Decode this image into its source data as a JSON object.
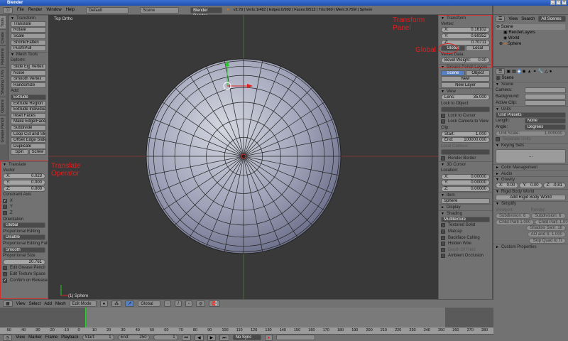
{
  "window": {
    "title": "Blender",
    "controls": [
      "_",
      "▫",
      "×"
    ]
  },
  "info": {
    "menus": [
      "File",
      "Render",
      "Window",
      "Help"
    ],
    "layout": "Default",
    "scene": "Scene",
    "engine": "Blender Render",
    "stats": "v2.79 | Verts:1/482 | Edges:0/992 | Faces:0/512 | Tris:960 | Mem:9.75M | Sphere"
  },
  "tool_tabs": [
    "Tools",
    "Create",
    "Relations",
    "Shading / UVs",
    "Options",
    "Grease Pencil"
  ],
  "toolbar": {
    "rows": [
      {
        "t": "hdr",
        "text": "Transform"
      },
      {
        "t": "btn",
        "text": "Translate"
      },
      {
        "t": "btn",
        "text": "Rotate"
      },
      {
        "t": "btn",
        "text": "Scale"
      },
      {
        "t": "btn",
        "text": "Shrink/Fatten"
      },
      {
        "t": "btn",
        "text": "Push/Pull"
      },
      {
        "t": "hdr",
        "text": "Mesh Tools"
      },
      {
        "t": "label",
        "text": "Deform:"
      },
      {
        "t": "pair",
        "a": "Slide Ed",
        "b": "Vertex"
      },
      {
        "t": "btn",
        "text": "Noise"
      },
      {
        "t": "btn",
        "text": "Smooth Vertex"
      },
      {
        "t": "btn",
        "text": "Randomize"
      },
      {
        "t": "label",
        "text": "Add:"
      },
      {
        "t": "select",
        "text": "Extrude"
      },
      {
        "t": "btn",
        "text": "Extrude Region"
      },
      {
        "t": "btn",
        "text": "Extrude Individual"
      },
      {
        "t": "btn",
        "text": "Inset Faces"
      },
      {
        "t": "btn",
        "text": "Make Edge/Face"
      },
      {
        "t": "btn",
        "text": "Subdivide"
      },
      {
        "t": "btn",
        "text": "Loop Cut and Slide"
      },
      {
        "t": "btn",
        "text": "Offset Edge Slide"
      },
      {
        "t": "btn",
        "text": "Duplicate"
      },
      {
        "t": "pair",
        "a": "Spin",
        "b": "Screw"
      }
    ]
  },
  "operator": {
    "rows": [
      {
        "t": "hdr",
        "text": "Translate"
      },
      {
        "t": "label",
        "text": "Vector"
      },
      {
        "t": "num",
        "label": "X:",
        "value": "0.023"
      },
      {
        "t": "num",
        "label": "Y:",
        "value": "0.000"
      },
      {
        "t": "num",
        "label": "Z:",
        "value": "0.000"
      },
      {
        "t": "label",
        "text": "Constraint Axis"
      },
      {
        "t": "check",
        "text": "X",
        "checked": true
      },
      {
        "t": "check",
        "text": "Y",
        "checked": false
      },
      {
        "t": "check",
        "text": "Z",
        "checked": false
      },
      {
        "t": "label",
        "text": "Orientation"
      },
      {
        "t": "select",
        "text": "Global"
      },
      {
        "t": "label",
        "text": "Proportional Editing"
      },
      {
        "t": "select",
        "text": "Disable"
      },
      {
        "t": "label",
        "text": "Proportional Editing Falloff"
      },
      {
        "t": "select",
        "text": "Smooth"
      },
      {
        "t": "label",
        "text": "Proportional Size"
      },
      {
        "t": "num",
        "label": "",
        "value": "20.761"
      },
      {
        "t": "check",
        "text": "Edit Grease Pencil",
        "checked": false
      },
      {
        "t": "check",
        "text": "Edit Texture Space",
        "checked": false
      },
      {
        "t": "check",
        "text": "Confirm on Release",
        "checked": true
      }
    ]
  },
  "viewport": {
    "view_name": "Top Ortho",
    "object_label": "(1) Sphere"
  },
  "annotations": {
    "transform_panel": "Transform Panel",
    "global": "Global",
    "translate_operator": "Translate Operator"
  },
  "npanel": {
    "rows": [
      {
        "t": "hdr",
        "text": "Transform"
      },
      {
        "t": "label",
        "text": "Vertex:"
      },
      {
        "t": "num",
        "label": "X:",
        "value": "0.16102"
      },
      {
        "t": "num",
        "label": "Y:",
        "value": "0.69352"
      },
      {
        "t": "num",
        "label": "Z:",
        "value": "0.70711"
      },
      {
        "t": "pair",
        "a": "Global",
        "b": "Local",
        "sel": "a"
      },
      {
        "t": "label",
        "text": "Vertex Data:"
      },
      {
        "t": "num",
        "label": "Bevel Weight:",
        "value": "0.00"
      },
      {
        "t": "hdr",
        "text": "Grease Pencil Layers"
      },
      {
        "t": "pair",
        "a": "Scene",
        "b": "Object",
        "on": "a"
      },
      {
        "t": "btn",
        "text": "New",
        "c": true
      },
      {
        "t": "btn",
        "text": "New Layer",
        "c": true
      },
      {
        "t": "hdr",
        "text": "View"
      },
      {
        "t": "num",
        "label": "Lens:",
        "value": "35.000"
      },
      {
        "t": "label",
        "text": "Lock to Object:"
      },
      {
        "t": "select",
        "text": ""
      },
      {
        "t": "check",
        "text": "Lock to Cursor",
        "checked": false
      },
      {
        "t": "check",
        "text": "Lock Camera to View",
        "checked": false
      },
      {
        "t": "label",
        "text": "Clip:"
      },
      {
        "t": "num",
        "label": "Start:",
        "value": "1.000"
      },
      {
        "t": "num",
        "label": "End:",
        "value": "100000.000"
      },
      {
        "t": "label",
        "text": "Local Camera:",
        "dis": true
      },
      {
        "t": "select",
        "text": ""
      },
      {
        "t": "check",
        "text": "Render Border",
        "checked": false
      },
      {
        "t": "hdr",
        "text": "3D Cursor"
      },
      {
        "t": "label",
        "text": "Location:"
      },
      {
        "t": "num",
        "label": "X:",
        "value": "0.00000"
      },
      {
        "t": "num",
        "label": "Y:",
        "value": "0.00000"
      },
      {
        "t": "num",
        "label": "Z:",
        "value": "0.00000"
      },
      {
        "t": "hdr",
        "text": "Item"
      },
      {
        "t": "btn",
        "text": "Sphere"
      },
      {
        "t": "hdr",
        "text": "Display",
        "closed": true
      },
      {
        "t": "hdr",
        "text": "Shading"
      },
      {
        "t": "select",
        "text": "Multitexture"
      },
      {
        "t": "check",
        "text": "Textured Solid",
        "checked": false
      },
      {
        "t": "check",
        "text": "Matcap",
        "checked": false
      },
      {
        "t": "check",
        "text": "Backface Culling",
        "checked": false
      },
      {
        "t": "check",
        "text": "Hidden Wire",
        "checked": false
      },
      {
        "t": "check",
        "text": "Depth Of Field",
        "checked": false,
        "dis": true
      },
      {
        "t": "check",
        "text": "Ambient Occlusion",
        "checked": false
      }
    ]
  },
  "outliner": {
    "view": "View",
    "search": "Search",
    "filter": "All Scenes",
    "tree": [
      "Scene",
      "RenderLayers",
      "World",
      "Sphere"
    ]
  },
  "properties": {
    "breadcrumb": "Scene",
    "rows": [
      {
        "t": "hdr",
        "text": "Scene"
      },
      {
        "t": "field",
        "label": "Camera:",
        "value": ""
      },
      {
        "t": "field",
        "label": "Background:",
        "value": ""
      },
      {
        "t": "field",
        "label": "Active Clip:",
        "value": ""
      },
      {
        "t": "hdr",
        "text": "Units"
      },
      {
        "t": "select",
        "text": "Unit Presets"
      },
      {
        "t": "field",
        "label": "Length:",
        "value": "None",
        "sel": true
      },
      {
        "t": "field",
        "label": "Angle:",
        "value": "Degrees",
        "sel": true
      },
      {
        "t": "num",
        "label": "Unit Scale:",
        "value": "1.000000",
        "dis": true
      },
      {
        "t": "check",
        "text": "Separate Units",
        "checked": false,
        "dis": true
      },
      {
        "t": "hdr",
        "text": "Keying Sets"
      },
      {
        "t": "box",
        "text": "..."
      },
      {
        "t": "hdr",
        "text": "Color Management",
        "closed": true
      },
      {
        "t": "hdr",
        "text": "Audio",
        "closed": true
      },
      {
        "t": "hdr",
        "text": "Gravity"
      },
      {
        "t": "triple",
        "items": [
          {
            "label": "X:",
            "value": "0.00"
          },
          {
            "label": "Y:",
            "value": "0.00"
          },
          {
            "label": "Z:",
            "value": "-9.81"
          }
        ]
      },
      {
        "t": "hdr",
        "text": "Rigid Body World"
      },
      {
        "t": "btn",
        "text": "Add Rigid Body World",
        "c": true
      },
      {
        "t": "hdr",
        "text": "Simplify"
      },
      {
        "t": "pairlab",
        "a": "Viewport:",
        "b": "Render:"
      },
      {
        "t": "pairnum",
        "a": "Subdivision: 6",
        "b": "Subdivision: 6"
      },
      {
        "t": "pairnum",
        "a": "Child Parti 1.000",
        "b": "Child Part: 1.000"
      },
      {
        "t": "pairnum",
        "a": "",
        "b": "Shadow Sam: 16"
      },
      {
        "t": "pairnum",
        "a": "",
        "b": "AO and S: 1.000"
      },
      {
        "t": "pairnum",
        "a": "",
        "b": "Skip Quad to Tr"
      },
      {
        "t": "hdr",
        "text": "Custom Properties",
        "closed": true
      }
    ]
  },
  "view3d_header": {
    "menus": [
      "View",
      "Select",
      "Add",
      "Mesh"
    ],
    "mode": "Edit Mode",
    "orientation": "Global"
  },
  "timeline": {
    "ticks": [
      "-50",
      "-40",
      "-30",
      "-20",
      "-10",
      "0",
      "10",
      "20",
      "30",
      "40",
      "50",
      "60",
      "70",
      "80",
      "90",
      "100",
      "110",
      "120",
      "130",
      "140",
      "150",
      "160",
      "170",
      "180",
      "190",
      "200",
      "210",
      "220",
      "230",
      "240",
      "250",
      "260",
      "270",
      "280"
    ],
    "menus": [
      "View",
      "Marker",
      "Frame",
      "Playback"
    ],
    "start_label": "Start:",
    "start": "1",
    "end_label": "End:",
    "end": "250",
    "current": "1",
    "sync": "No Sync"
  },
  "colors": {
    "accent": "#5680c2",
    "annotation": "#e02020",
    "viewport_bg": "#393939"
  }
}
